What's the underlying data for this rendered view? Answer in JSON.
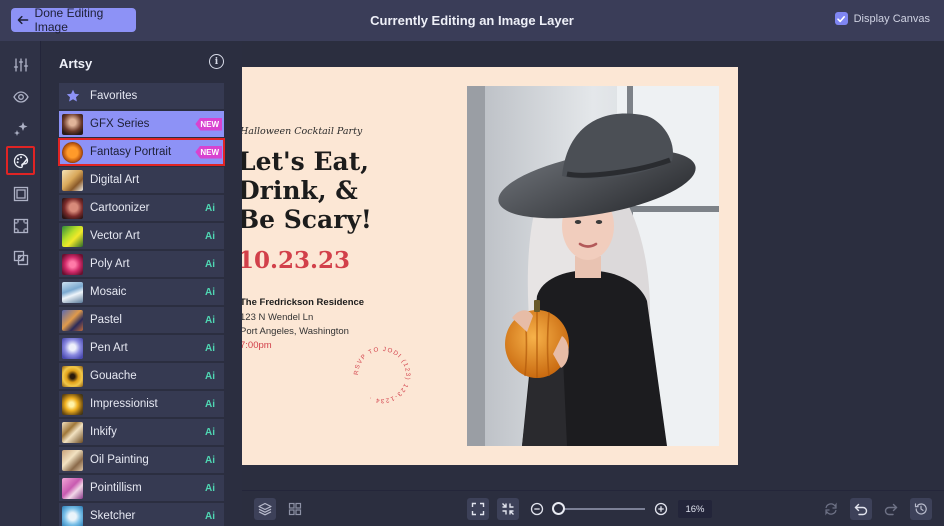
{
  "topbar": {
    "done_label": "Done Editing Image",
    "title": "Currently Editing an Image Layer",
    "display_canvas_label": "Display Canvas",
    "display_canvas_checked": true
  },
  "panel": {
    "title": "Artsy",
    "items": [
      {
        "label": "Favorites",
        "badge": ""
      },
      {
        "label": "GFX Series",
        "badge": "NEW"
      },
      {
        "label": "Fantasy Portrait",
        "badge": "NEW"
      },
      {
        "label": "Digital Art",
        "badge": ""
      },
      {
        "label": "Cartoonizer",
        "badge": "Ai"
      },
      {
        "label": "Vector Art",
        "badge": "Ai"
      },
      {
        "label": "Poly Art",
        "badge": "Ai"
      },
      {
        "label": "Mosaic",
        "badge": "Ai"
      },
      {
        "label": "Pastel",
        "badge": "Ai"
      },
      {
        "label": "Pen Art",
        "badge": "Ai"
      },
      {
        "label": "Gouache",
        "badge": "Ai"
      },
      {
        "label": "Impressionist",
        "badge": "Ai"
      },
      {
        "label": "Inkify",
        "badge": "Ai"
      },
      {
        "label": "Oil Painting",
        "badge": "Ai"
      },
      {
        "label": "Pointillism",
        "badge": "Ai"
      },
      {
        "label": "Sketcher",
        "badge": "Ai"
      }
    ]
  },
  "card": {
    "subhead": "Halloween Cocktail Party",
    "headline_1": "Let's Eat,",
    "headline_2": "Drink, &",
    "headline_3": "Be Scary!",
    "date": "10.23.23",
    "address_name": "The Fredrickson Residence",
    "address_street": "123 N Wendel Ln",
    "address_city": "Port Angeles, Washington",
    "time": "7:00pm",
    "rsvp_text": "RSVP TO JODI (123) 123-1234 ·"
  },
  "zoom": {
    "value": "16%"
  },
  "colors": {
    "accent": "#8d92f6",
    "ai_badge": "#4fd7b3",
    "new_badge": "#d843d0",
    "highlight_outline": "#e02424"
  }
}
